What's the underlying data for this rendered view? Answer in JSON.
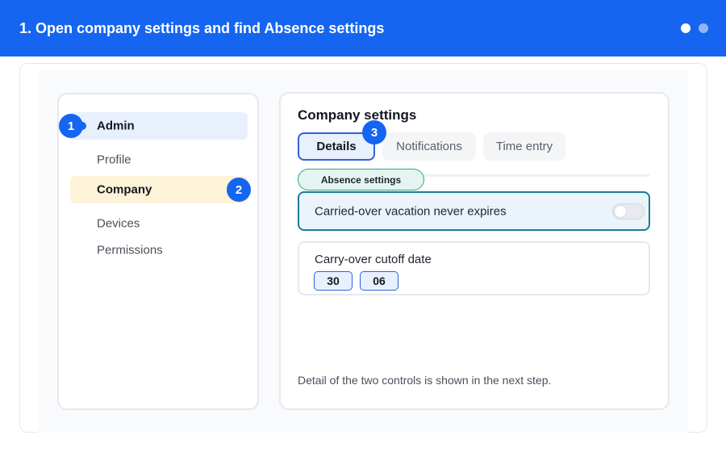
{
  "banner": {
    "title": "1. Open company settings and find Absence settings",
    "colors": {
      "background": "#1565f0",
      "active_dot": "#ffffff",
      "inactive_dot": "#8fb4f8"
    },
    "pager": {
      "total": 2,
      "active": 1
    }
  },
  "sidebar": {
    "items": [
      {
        "label": "Admin",
        "highlight": "blue"
      },
      {
        "label": "Profile"
      },
      {
        "label": "Company",
        "highlight": "yellow"
      },
      {
        "label": "Devices"
      },
      {
        "label": "Permissions"
      }
    ]
  },
  "steps": {
    "one": "1",
    "two": "2",
    "three": "3"
  },
  "panel": {
    "title": "Company settings",
    "tabs": [
      {
        "label": "Details",
        "selected": true
      },
      {
        "label": "Notifications"
      },
      {
        "label": "Time entry"
      }
    ],
    "section_label": "Absence settings",
    "toggle": {
      "label": "Carried-over vacation never expires",
      "on": false
    },
    "cutoff": {
      "label": "Carry-over cutoff date",
      "day": "30",
      "month": "06"
    },
    "footnote": "Detail of the two controls is shown in the next step."
  },
  "colors": {
    "accent": "#1565f0",
    "admin_highlight": "#e8f0fd",
    "company_highlight": "#fdf3d8",
    "toggle_card_border": "#1f7a96",
    "section_pill_border": "#2aa58e"
  }
}
